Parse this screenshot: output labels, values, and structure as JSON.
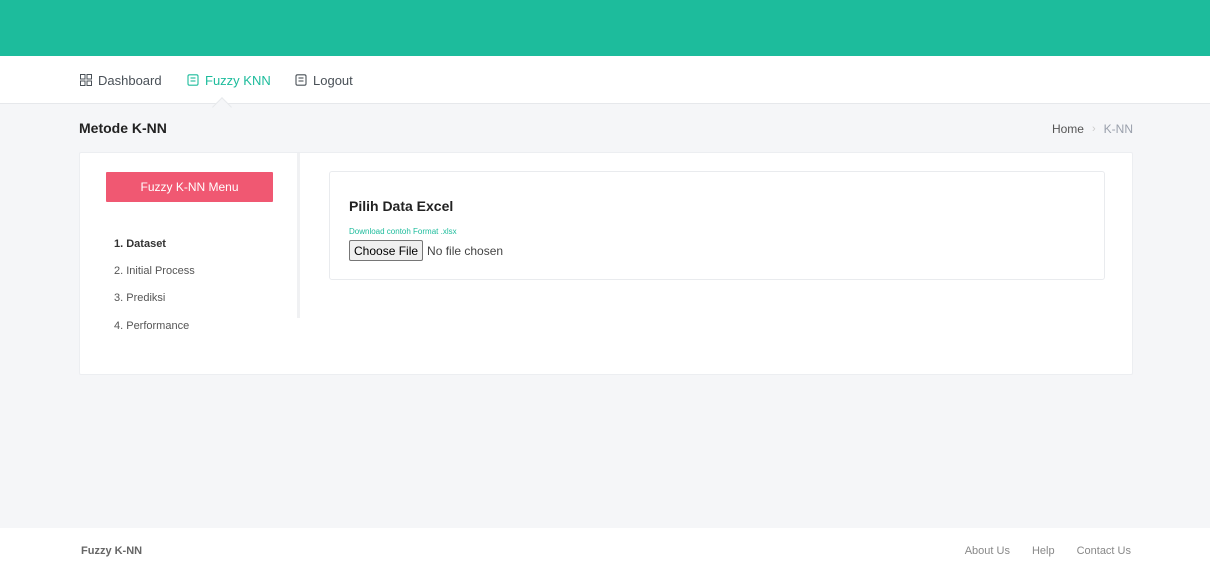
{
  "nav": {
    "dashboard": "Dashboard",
    "fuzzy_knn": "Fuzzy KNN",
    "logout": "Logout"
  },
  "page": {
    "title": "Metode K-NN"
  },
  "breadcrumb": {
    "home": "Home",
    "separator": "›",
    "current": "K-NN"
  },
  "sidebar": {
    "menu_button": "Fuzzy K-NN Menu",
    "items": [
      {
        "label": "1. Dataset",
        "active": true
      },
      {
        "label": "2. Initial Process",
        "active": false
      },
      {
        "label": "3. Prediksi",
        "active": false
      },
      {
        "label": "4. Performance",
        "active": false
      }
    ]
  },
  "upload": {
    "title": "Pilih Data Excel",
    "download_link": "Download contoh Format .xlsx",
    "choose_button": "Choose File",
    "file_status": "No file chosen"
  },
  "footer": {
    "brand": "Fuzzy K-NN",
    "links": [
      "About Us",
      "Help",
      "Contact Us"
    ]
  },
  "colors": {
    "accent": "#1dbc9c",
    "menu_button": "#f05872"
  },
  "icons": {
    "dashboard": "grid-icon",
    "fuzzy_knn": "document-icon",
    "logout": "document-icon"
  }
}
